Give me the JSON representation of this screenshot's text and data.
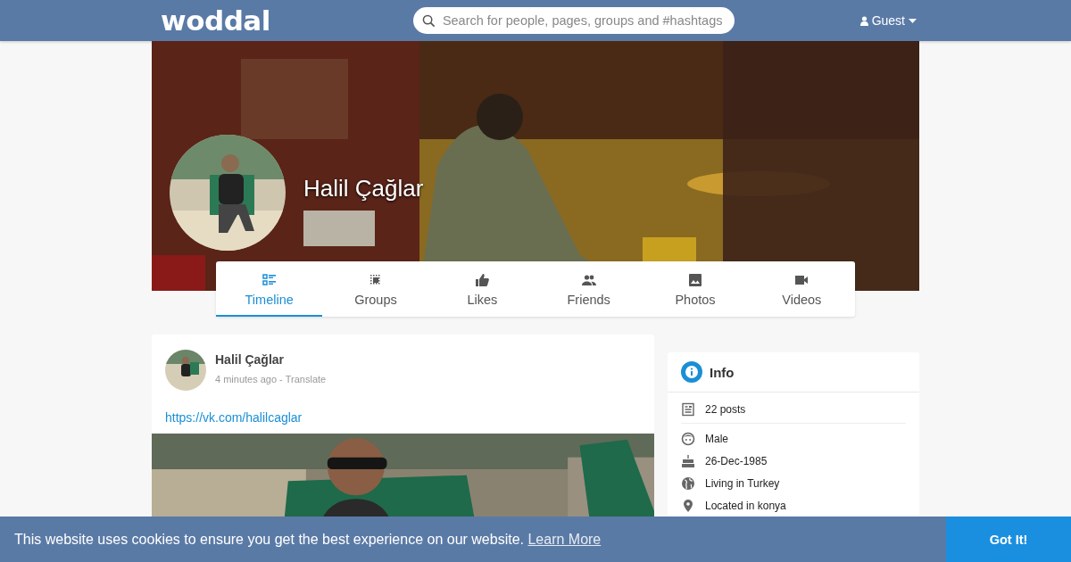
{
  "header": {
    "logo": "woddal",
    "search": {
      "placeholder": "Search for people, pages, groups and #hashtags"
    },
    "user": "Guest"
  },
  "profile": {
    "name": "Halil Çağlar"
  },
  "tabs": [
    {
      "label": "Timeline",
      "kind": "timeline",
      "selected": true
    },
    {
      "label": "Groups",
      "kind": "groups",
      "selected": false
    },
    {
      "label": "Likes",
      "kind": "likes",
      "selected": false
    },
    {
      "label": "Friends",
      "kind": "friends",
      "selected": false
    },
    {
      "label": "Photos",
      "kind": "photos",
      "selected": false
    },
    {
      "label": "Videos",
      "kind": "videos",
      "selected": false
    }
  ],
  "post": {
    "author": "Halil Çağlar",
    "time": "4 minutes ago",
    "separator": "-",
    "translate": "Translate",
    "link": "https://vk.com/halilcaglar"
  },
  "info": {
    "title": "Info",
    "items": [
      {
        "kind": "posts",
        "text": "22 posts"
      },
      {
        "kind": "gender",
        "text": "Male"
      },
      {
        "kind": "birthday",
        "text": "26-Dec-1985"
      },
      {
        "kind": "living",
        "text": "Living in Turkey"
      },
      {
        "kind": "location",
        "text": "Located in konya"
      }
    ]
  },
  "cookie": {
    "message": "This website uses cookies to ensure you get the best experience on our website.",
    "link": "Learn More",
    "button": "Got It!"
  }
}
